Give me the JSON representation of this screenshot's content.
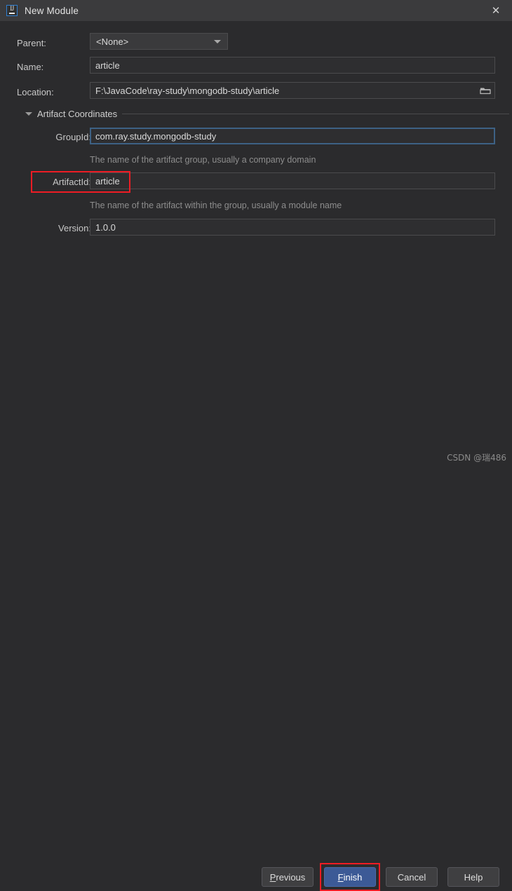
{
  "window": {
    "title": "New Module",
    "app_icon": "intellij-idea-icon",
    "icon_text": "IJ",
    "close_label": "✕"
  },
  "form": {
    "parent": {
      "label": "Parent:",
      "value": "<None>",
      "icon": "chevron-down-icon"
    },
    "name": {
      "label": "Name:",
      "value": "article"
    },
    "location": {
      "label": "Location:",
      "value": "F:\\JavaCode\\ray-study\\mongodb-study\\article",
      "browse_icon": "folder-icon"
    },
    "section": {
      "title": "Artifact Coordinates",
      "toggle_icon": "triangle-down-icon"
    },
    "group_id": {
      "label": "GroupId:",
      "value": "com.ray.study.mongodb-study",
      "hint": "The name of the artifact group, usually a company domain"
    },
    "artifact_id": {
      "label": "ArtifactId:",
      "value": "article",
      "hint": "The name of the artifact within the group, usually a module name"
    },
    "version": {
      "label": "Version:",
      "value": "1.0.0"
    }
  },
  "buttons": {
    "previous": "Previous",
    "previous_mnemonic": "P",
    "finish": "Finish",
    "finish_mnemonic": "F",
    "cancel": "Cancel",
    "help": "Help"
  },
  "watermark": "CSDN @瑞486",
  "colors": {
    "background": "#2b2b2d",
    "titlebar": "#3b3b3d",
    "accent_blue": "#3c5a96",
    "focus_border": "#3d6185",
    "annotation_red": "#ee1c24",
    "text": "#d8d8d8",
    "hint_text": "#8d8d8d"
  }
}
